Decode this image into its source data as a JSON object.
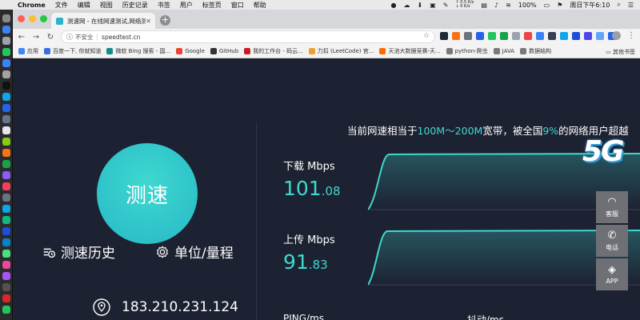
{
  "menubar": {
    "app": "Chrome",
    "items": [
      "文件",
      "编辑",
      "视图",
      "历史记录",
      "书签",
      "用户",
      "标签页",
      "窗口",
      "帮助"
    ],
    "net_up": "↑ 0.5 K/s",
    "net_down": "↓ 0 K/s",
    "battery": "100%",
    "clock": "周日下午6:10"
  },
  "browser": {
    "tab_title": "测速网 - 在线网速测试,网络测速",
    "address_security": "不安全",
    "address_url": "speedtest.cn",
    "bookmarks": [
      {
        "label": "应用",
        "color": "#4285f4"
      },
      {
        "label": "百度一下, 你就知道",
        "color": "#3b6fd8"
      },
      {
        "label": "微软 Bing 搜索 - 国...",
        "color": "#158c8c"
      },
      {
        "label": "Google",
        "color": "#ea4335"
      },
      {
        "label": "GitHub",
        "color": "#333333"
      },
      {
        "label": "我的工作台 - 码云...",
        "color": "#c71d23"
      },
      {
        "label": "力扣 (LeetCode) 官...",
        "color": "#f0a030"
      },
      {
        "label": "天池大数据竞赛-天...",
        "color": "#ff6a00"
      },
      {
        "label": "python-爬虫",
        "color": "#7a7a7a"
      },
      {
        "label": "JAVA",
        "color": "#7a7a7a"
      },
      {
        "label": "数据结构",
        "color": "#7a7a7a"
      }
    ],
    "other_bookmarks": "其他书签"
  },
  "page": {
    "speed_button": "测速",
    "history_link": "测速历史",
    "units_link": "单位/量程",
    "ip": "183.210.231.124",
    "summary_prefix": "当前网速相当于",
    "summary_range": "100M～200M",
    "summary_middle": "宽带，被全国",
    "summary_percent": "9%",
    "summary_suffix": "的网络用户超越",
    "download_label": "下载 Mbps",
    "download_int": "101",
    "download_dec": ".08",
    "upload_label": "上传 Mbps",
    "upload_int": "91",
    "upload_dec": ".83",
    "ping_label": "PING/ms",
    "jitter_label": "抖动/ms",
    "logo": "5G",
    "side_service": "客服",
    "side_phone": "电话",
    "side_app": "APP"
  },
  "colors": {
    "accent": "#3fd8d0",
    "background": "#1d2232"
  }
}
